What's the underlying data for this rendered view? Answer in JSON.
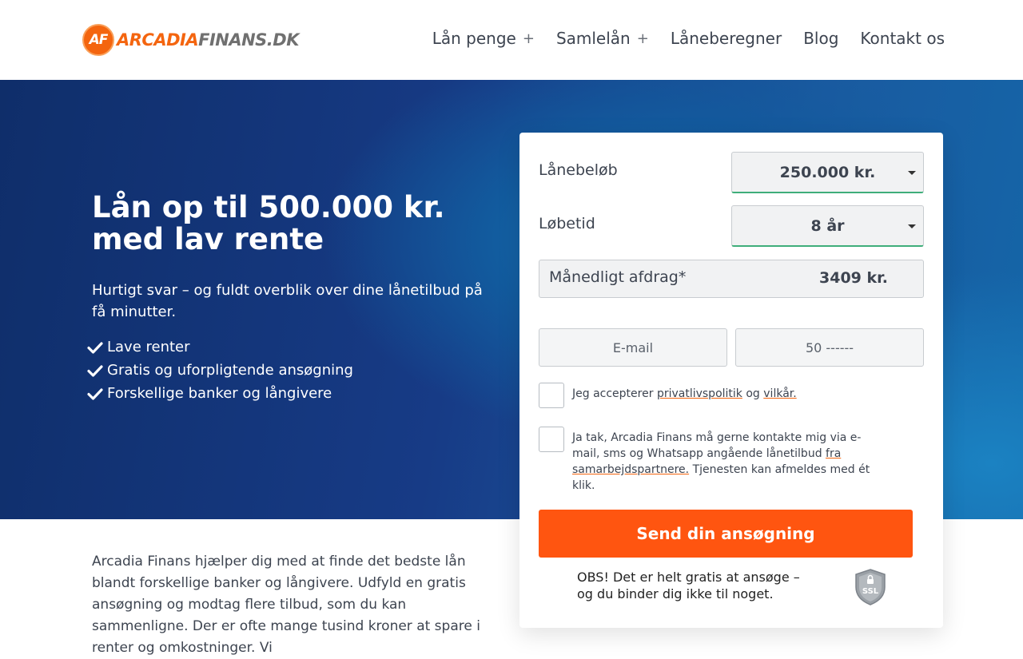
{
  "header": {
    "logo": {
      "badge": "AF",
      "text_a": "ARCADIA",
      "text_b": "FINANS.DK"
    },
    "nav": [
      {
        "label": "Lån penge",
        "plus": "+"
      },
      {
        "label": "Samlelån",
        "plus": "+"
      },
      {
        "label": "Låneberegner"
      },
      {
        "label": "Blog"
      },
      {
        "label": "Kontakt os"
      }
    ]
  },
  "hero": {
    "title": "Lån op til 500.000 kr. med lav rente",
    "subtitle": "Hurtigt svar – og fuldt overblik over dine lånetilbud på få minutter.",
    "benefits": [
      "Lave renter",
      "Gratis og uforpligtende ansøgning",
      "Forskellige banker og långivere"
    ]
  },
  "form": {
    "amount_label": "Lånebeløb",
    "amount_value": "250.000 kr.",
    "term_label": "Løbetid",
    "term_value": "8 år",
    "payment_label": "Månedligt afdrag*",
    "payment_value": "3409 kr.",
    "email_placeholder": "E-mail",
    "phone_placeholder": "50 ------",
    "terms": {
      "pre": "Jeg accepterer ",
      "privacy": "privatlivspolitik",
      "mid": " og ",
      "terms": "vilkår."
    },
    "consent": {
      "pre": "Ja tak, Arcadia Finans må gerne kontakte mig via e-mail, sms og Whatsapp angående lånetilbud ",
      "link": "fra samarbejdspartnere.",
      "post": " Tjenesten kan afmeldes med ét klik."
    },
    "submit_label": "Send din ansøgning",
    "note": "OBS! Det er helt gratis at ansøge – og du binder dig ikke til noget.",
    "ssl_label": "SSL"
  },
  "intro": "Arcadia Finans hjælper dig med at finde det bedste lån blandt forskellige banker og långivere. Udfyld en gratis ansøgning og modtag flere tilbud, som du kan sammenligne. Der er ofte mange tusind kroner at spare i renter og omkostninger. Vi",
  "colors": {
    "accent": "#ff5510",
    "brand_orange": "#f4650f",
    "valid_green": "#3fae7a",
    "hero_blue": "#173b86"
  }
}
